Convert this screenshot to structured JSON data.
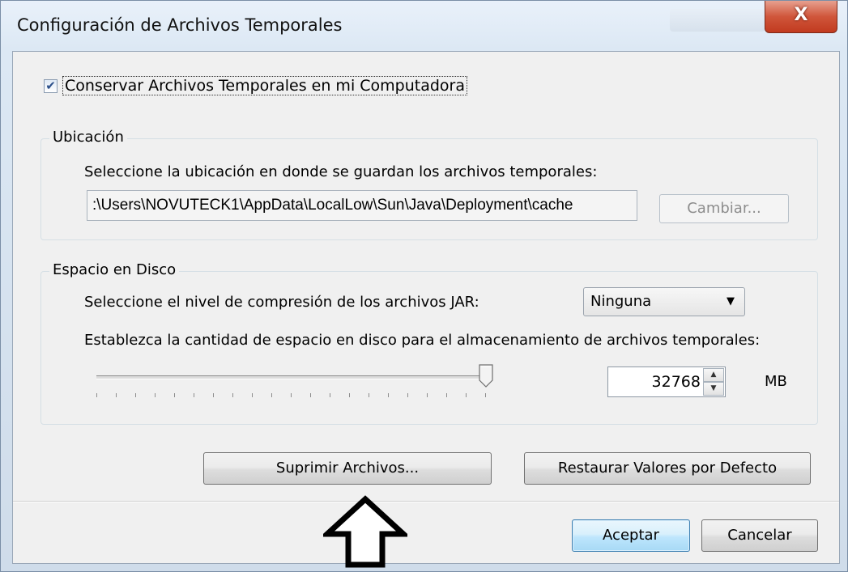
{
  "window": {
    "title": "Configuración de Archivos Temporales",
    "close_glyph": "X"
  },
  "keep_files": {
    "label": "Conservar Archivos Temporales en mi Computadora",
    "checked": true
  },
  "location": {
    "group_title": "Ubicación",
    "instruction": "Seleccione la ubicación en donde se guardan los archivos temporales:",
    "path": ":\\Users\\NOVUTECK1\\AppData\\LocalLow\\Sun\\Java\\Deployment\\cache",
    "change_button": "Cambiar..."
  },
  "disk_space": {
    "group_title": "Espacio en Disco",
    "compression_label": "Seleccione el nivel de compresión de los archivos JAR:",
    "compression_value": "Ninguna",
    "space_label": "Establezca la cantidad de espacio en disco para el almacenamiento de archivos temporales:",
    "slider_level": 1.0,
    "space_value": "32768",
    "unit": "MB"
  },
  "actions": {
    "delete_files": "Suprimir Archivos...",
    "restore_defaults": "Restaurar Valores por Defecto"
  },
  "footer": {
    "accept": "Aceptar",
    "cancel": "Cancelar"
  },
  "icons": {
    "dropdown": "chevron-down-icon",
    "annotation": "up-arrow-icon"
  }
}
